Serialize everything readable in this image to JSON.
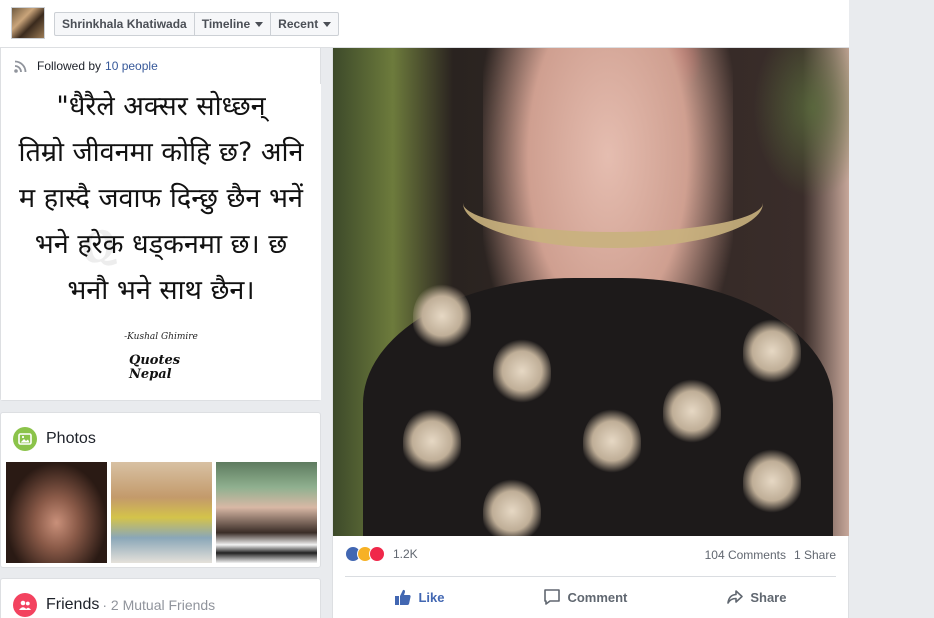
{
  "header": {
    "name": "Shrinkhala Khatiwada",
    "timeline_label": "Timeline",
    "recent_label": "Recent"
  },
  "intro": {
    "followed_prefix": "Followed by",
    "followed_link": "10 people"
  },
  "quote_image": {
    "lines": [
      "\"धैरैले अक्सर सोध्छन्",
      "तिम्रो जीवनमा कोहि छ? अनि",
      "म हास्दै जवाफ दिन्छु छैन भनें",
      "भने हरेक धड्कनमा छ। छ",
      "भनौ भने साथ छैन।"
    ],
    "author": "-Kushal Ghimire",
    "logo_line1": "Quotes",
    "logo_line2": "Nepal"
  },
  "photos": {
    "title": "Photos",
    "icon": "photo-icon",
    "accent": "#8bc34a"
  },
  "friends": {
    "title": "Friends",
    "subtitle": "· 2 Mutual Friends",
    "icon": "friends-icon",
    "accent": "#f3425f"
  },
  "post": {
    "reaction_count": "1.2K",
    "comments": "104 Comments",
    "shares": "1 Share",
    "actions": {
      "like": "Like",
      "comment": "Comment",
      "share": "Share"
    }
  },
  "colors": {
    "link": "#365899",
    "like_blue": "#4267b2",
    "love_red": "#f0284a",
    "haha_yellow": "#f7b125"
  }
}
